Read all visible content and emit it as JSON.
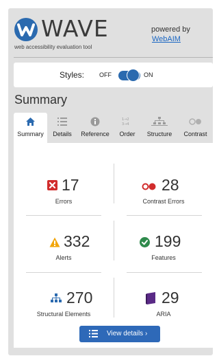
{
  "header": {
    "logo_text": "WAVE",
    "tagline": "web accessibility evaluation tool",
    "powered_by": "powered by",
    "webaim_link": "WebAIM"
  },
  "styles": {
    "label": "Styles:",
    "off": "OFF",
    "on": "ON"
  },
  "summary_heading": "Summary",
  "tabs": [
    {
      "label": "Summary",
      "icon": "home-icon"
    },
    {
      "label": "Details",
      "icon": "list-icon"
    },
    {
      "label": "Reference",
      "icon": "info-icon"
    },
    {
      "label": "Order",
      "icon": "order-icon"
    },
    {
      "label": "Structure",
      "icon": "structure-icon"
    },
    {
      "label": "Contrast",
      "icon": "contrast-icon"
    }
  ],
  "stats": {
    "errors": {
      "value": "17",
      "label": "Errors"
    },
    "contrast_errors": {
      "value": "28",
      "label": "Contrast Errors"
    },
    "alerts": {
      "value": "332",
      "label": "Alerts"
    },
    "features": {
      "value": "199",
      "label": "Features"
    },
    "structural": {
      "value": "270",
      "label": "Structural Elements"
    },
    "aria": {
      "value": "29",
      "label": "ARIA"
    }
  },
  "view_details": "View details ›",
  "colors": {
    "brand": "#2b6aaf",
    "error": "#d12c2c",
    "alert": "#f2a60a",
    "feature": "#2f8a4c",
    "aria": "#5a2a86"
  }
}
